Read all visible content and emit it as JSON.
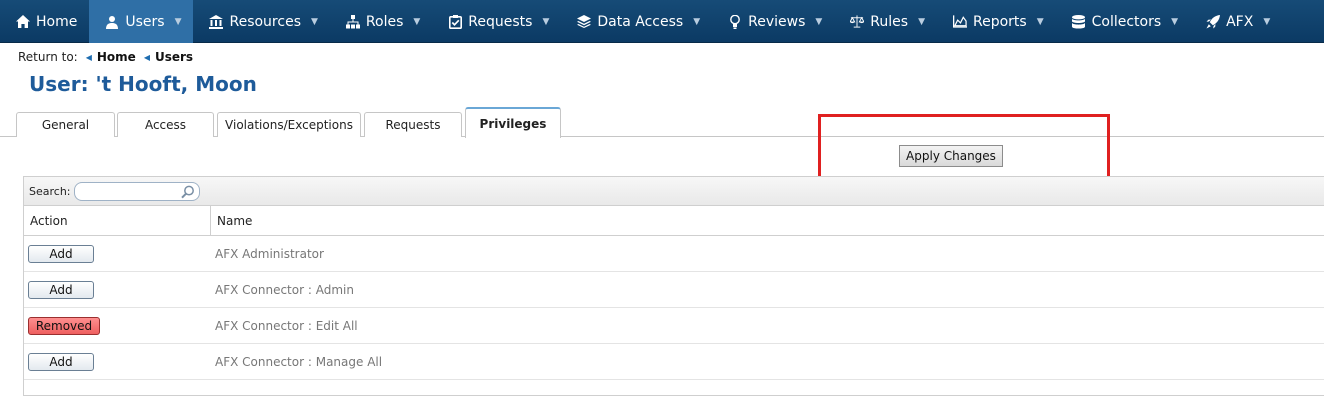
{
  "nav": {
    "items": [
      {
        "label": "Home",
        "icon": "home-icon",
        "caret": false,
        "active": false
      },
      {
        "label": "Users",
        "icon": "user-icon",
        "caret": true,
        "active": true
      },
      {
        "label": "Resources",
        "icon": "bank-icon",
        "caret": true,
        "active": false
      },
      {
        "label": "Roles",
        "icon": "org-chart-icon",
        "caret": true,
        "active": false
      },
      {
        "label": "Requests",
        "icon": "clipboard-check-icon",
        "caret": true,
        "active": false
      },
      {
        "label": "Data Access",
        "icon": "layers-icon",
        "caret": true,
        "active": false
      },
      {
        "label": "Reviews",
        "icon": "lightbulb-icon",
        "caret": true,
        "active": false
      },
      {
        "label": "Rules",
        "icon": "scale-icon",
        "caret": true,
        "active": false
      },
      {
        "label": "Reports",
        "icon": "area-chart-icon",
        "caret": true,
        "active": false
      },
      {
        "label": "Collectors",
        "icon": "database-icon",
        "caret": true,
        "active": false
      },
      {
        "label": "AFX",
        "icon": "rocket-icon",
        "caret": true,
        "active": false
      }
    ]
  },
  "breadcrumb": {
    "prefix": "Return to:",
    "links": [
      "Home",
      "Users"
    ]
  },
  "page": {
    "title": "User: 't Hooft, Moon"
  },
  "tabs": [
    {
      "label": "General",
      "active": false
    },
    {
      "label": "Access",
      "active": false
    },
    {
      "label": "Violations/Exceptions",
      "active": false
    },
    {
      "label": "Requests",
      "active": false
    },
    {
      "label": "Privileges",
      "active": true
    }
  ],
  "apply": {
    "label": "Apply Changes"
  },
  "grid": {
    "search_label": "Search:",
    "search_value": "",
    "columns": [
      "Action",
      "Name"
    ],
    "rows": [
      {
        "action": "Add",
        "name": "AFX Administrator",
        "state": "add"
      },
      {
        "action": "Add",
        "name": "AFX Connector : Admin",
        "state": "add"
      },
      {
        "action": "Removed",
        "name": "AFX Connector : Edit All",
        "state": "removed"
      },
      {
        "action": "Add",
        "name": "AFX Connector : Manage All",
        "state": "add"
      }
    ]
  },
  "colors": {
    "nav_bg": "#0b3a64",
    "nav_active": "#2f6fa6",
    "title": "#1e5b9a",
    "highlight_box": "#e02020",
    "removed_button": "#ef5f5f"
  }
}
